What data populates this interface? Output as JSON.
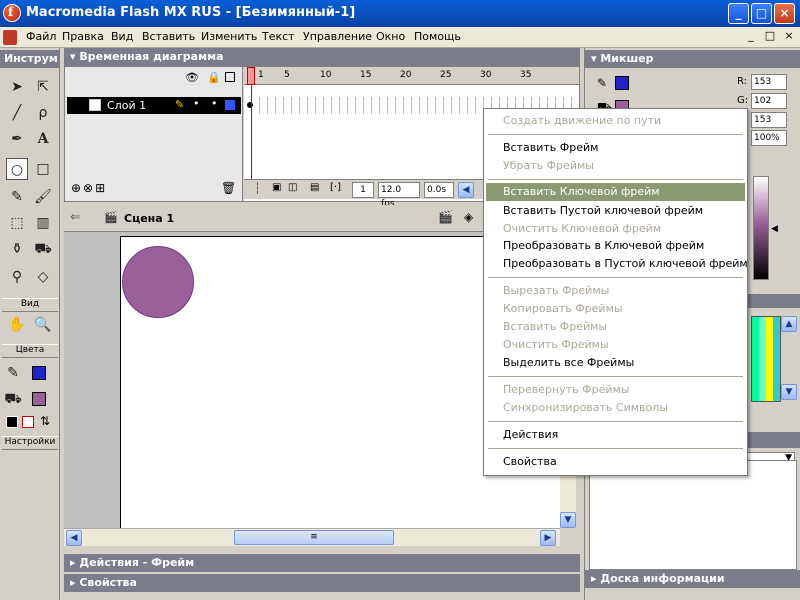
{
  "window": {
    "title": "Macromedia Flash MX RUS - [Безимянный-1]",
    "logo_letter": "f",
    "buttons": {
      "minimize": "_",
      "maximize": "□",
      "close": "×"
    }
  },
  "menubar": {
    "items": [
      "Файл",
      "Правка",
      "Вид",
      "Вставить",
      "Изменить",
      "Текст",
      "Управление",
      "Окно",
      "Помощь"
    ],
    "mdi_buttons": [
      "_",
      "□",
      "×"
    ]
  },
  "toolbox": {
    "title": "Инструм",
    "sections": {
      "view": "Вид",
      "colors": "Цвета",
      "options": "Настройки"
    }
  },
  "timeline": {
    "title": "Временная диаграмма",
    "layer_name": "Слой 1",
    "frame_numbers": [
      "1",
      "5",
      "10",
      "15",
      "20",
      "25",
      "30",
      "35"
    ],
    "current_frame": "1",
    "fps": "12.0 fps",
    "time": "0.0s"
  },
  "scene": {
    "name": "Сцена 1"
  },
  "bottom_panels": {
    "actions": "Действия - Фрейм",
    "properties": "Свойства"
  },
  "right_panel": {
    "mixer_title": "Микшер",
    "rgb": {
      "r_label": "R:",
      "r": "153",
      "g_label": "G:",
      "g": "102",
      "b_label": "B:",
      "b": "153",
      "alpha": "100%"
    },
    "info_title": "Доска информации"
  },
  "context_menu": {
    "groups": [
      [
        {
          "label": "Создать движение по пути",
          "enabled": false
        }
      ],
      [
        {
          "label": "Вставить Фрейм",
          "enabled": true
        },
        {
          "label": "Убрать Фреймы",
          "enabled": false
        }
      ],
      [
        {
          "label": "Вставить Ключевой фрейм",
          "enabled": true,
          "highlighted": true
        },
        {
          "label": "Вставить Пустой ключевой фрейм",
          "enabled": true
        },
        {
          "label": "Очистить Ключевой фрейм",
          "enabled": false
        },
        {
          "label": "Преобразовать в Ключевой фрейм",
          "enabled": true
        },
        {
          "label": "Преобразовать в Пустой ключевой фрейм",
          "enabled": true
        }
      ],
      [
        {
          "label": "Вырезать Фреймы",
          "enabled": false
        },
        {
          "label": "Копировать Фреймы",
          "enabled": false
        },
        {
          "label": "Вставить Фреймы",
          "enabled": false
        },
        {
          "label": "Очистить Фреймы",
          "enabled": false
        },
        {
          "label": "Выделить все Фреймы",
          "enabled": true
        }
      ],
      [
        {
          "label": "Перевернуть Фреймы",
          "enabled": false
        },
        {
          "label": "Синхронизировать Символы",
          "enabled": false
        }
      ],
      [
        {
          "label": "Действия",
          "enabled": true
        }
      ],
      [
        {
          "label": "Свойства",
          "enabled": true
        }
      ]
    ]
  },
  "colors": {
    "stroke": "#2222cc",
    "fill": "#9a609a",
    "highlight": "#8c9a72",
    "titlebar": "#0a5fd6"
  },
  "icons": [
    "arrow-icon",
    "subselect-icon",
    "line-icon",
    "lasso-icon",
    "pen-icon",
    "text-icon",
    "oval-icon",
    "rectangle-icon",
    "pencil-icon",
    "brush-icon",
    "free-transform-icon",
    "fill-transform-icon",
    "ink-bottle-icon",
    "paint-bucket-icon",
    "eyedropper-icon",
    "eraser-icon",
    "hand-icon",
    "zoom-icon"
  ]
}
